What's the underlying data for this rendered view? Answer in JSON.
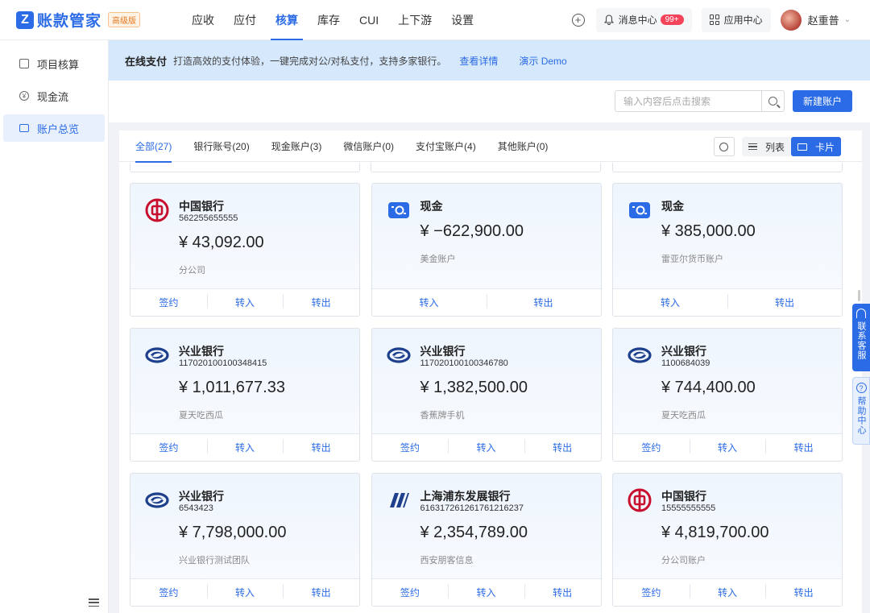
{
  "app": {
    "logo_mark": "Z",
    "title": "账款管家",
    "badge": "高级版"
  },
  "nav": [
    {
      "label": "应收"
    },
    {
      "label": "应付"
    },
    {
      "label": "核算",
      "active": true
    },
    {
      "label": "库存"
    },
    {
      "label": "CUI"
    },
    {
      "label": "上下游"
    },
    {
      "label": "设置"
    }
  ],
  "header": {
    "messages_label": "消息中心",
    "messages_count": "99+",
    "apps_label": "应用中心",
    "user_name": "赵重普"
  },
  "sidebar": {
    "items": [
      {
        "label": "项目核算",
        "icon": "document-icon"
      },
      {
        "label": "现金流",
        "icon": "coin-icon"
      },
      {
        "label": "账户总览",
        "icon": "card-icon",
        "active": true
      }
    ]
  },
  "banner": {
    "title": "在线支付",
    "text": "打造高效的支付体验，一键完成对公/对私支付，支持多家银行。",
    "link_details": "查看详情",
    "link_demo": "演示 Demo"
  },
  "toolbar": {
    "search_placeholder": "输入内容后点击搜索",
    "new_account_label": "新建账户"
  },
  "tabs": [
    {
      "label": "全部(27)",
      "active": true
    },
    {
      "label": "银行账号(20)"
    },
    {
      "label": "现金账户(3)"
    },
    {
      "label": "微信账户(0)"
    },
    {
      "label": "支付宝账户(4)"
    },
    {
      "label": "其他账户(0)"
    }
  ],
  "view": {
    "list_label": "列表",
    "card_label": "卡片"
  },
  "actions": {
    "sign": "签约",
    "in": "转入",
    "out": "转出"
  },
  "cards": [
    {
      "bank": "中国银行",
      "account": "562255655555",
      "amount": "¥ 43,092.00",
      "note": "分公司",
      "logo": "boc-logo",
      "sign": true
    },
    {
      "bank": "现金",
      "account": "",
      "amount": "¥ −622,900.00",
      "note": "美金账户",
      "logo": "cash-logo",
      "sign": false
    },
    {
      "bank": "现金",
      "account": "",
      "amount": "¥ 385,000.00",
      "note": "雷亚尔货币账户",
      "logo": "cash-logo",
      "sign": false
    },
    {
      "bank": "兴业银行",
      "account": "117020100100348415",
      "amount": "¥ 1,011,677.33",
      "note": "夏天吃西瓜",
      "logo": "cib-logo",
      "sign": true
    },
    {
      "bank": "兴业银行",
      "account": "117020100100346780",
      "amount": "¥ 1,382,500.00",
      "note": "香蕉牌手机",
      "logo": "cib-logo",
      "sign": true
    },
    {
      "bank": "兴业银行",
      "account": "1100684039",
      "amount": "¥ 744,400.00",
      "note": "夏天吃西瓜",
      "logo": "cib-logo",
      "sign": true
    },
    {
      "bank": "兴业银行",
      "account": "6543423",
      "amount": "¥ 7,798,000.00",
      "note": "兴业银行测试团队",
      "logo": "cib-logo",
      "sign": true
    },
    {
      "bank": "上海浦东发展银行",
      "account": "616317261261761216237",
      "amount": "¥ 2,354,789.00",
      "note": "西安朋客信息",
      "logo": "spdb-logo",
      "sign": true
    },
    {
      "bank": "中国银行",
      "account": "15555555555",
      "amount": "¥ 4,819,700.00",
      "note": "分公司账户",
      "logo": "boc-logo",
      "sign": true
    }
  ],
  "float": {
    "service": "联系客服",
    "help": "帮助中心"
  },
  "colors": {
    "primary": "#2b6be6",
    "banner_bg": "#d6e8fb",
    "boc_red": "#c8102e",
    "cib_navy": "#1d3f8c"
  }
}
